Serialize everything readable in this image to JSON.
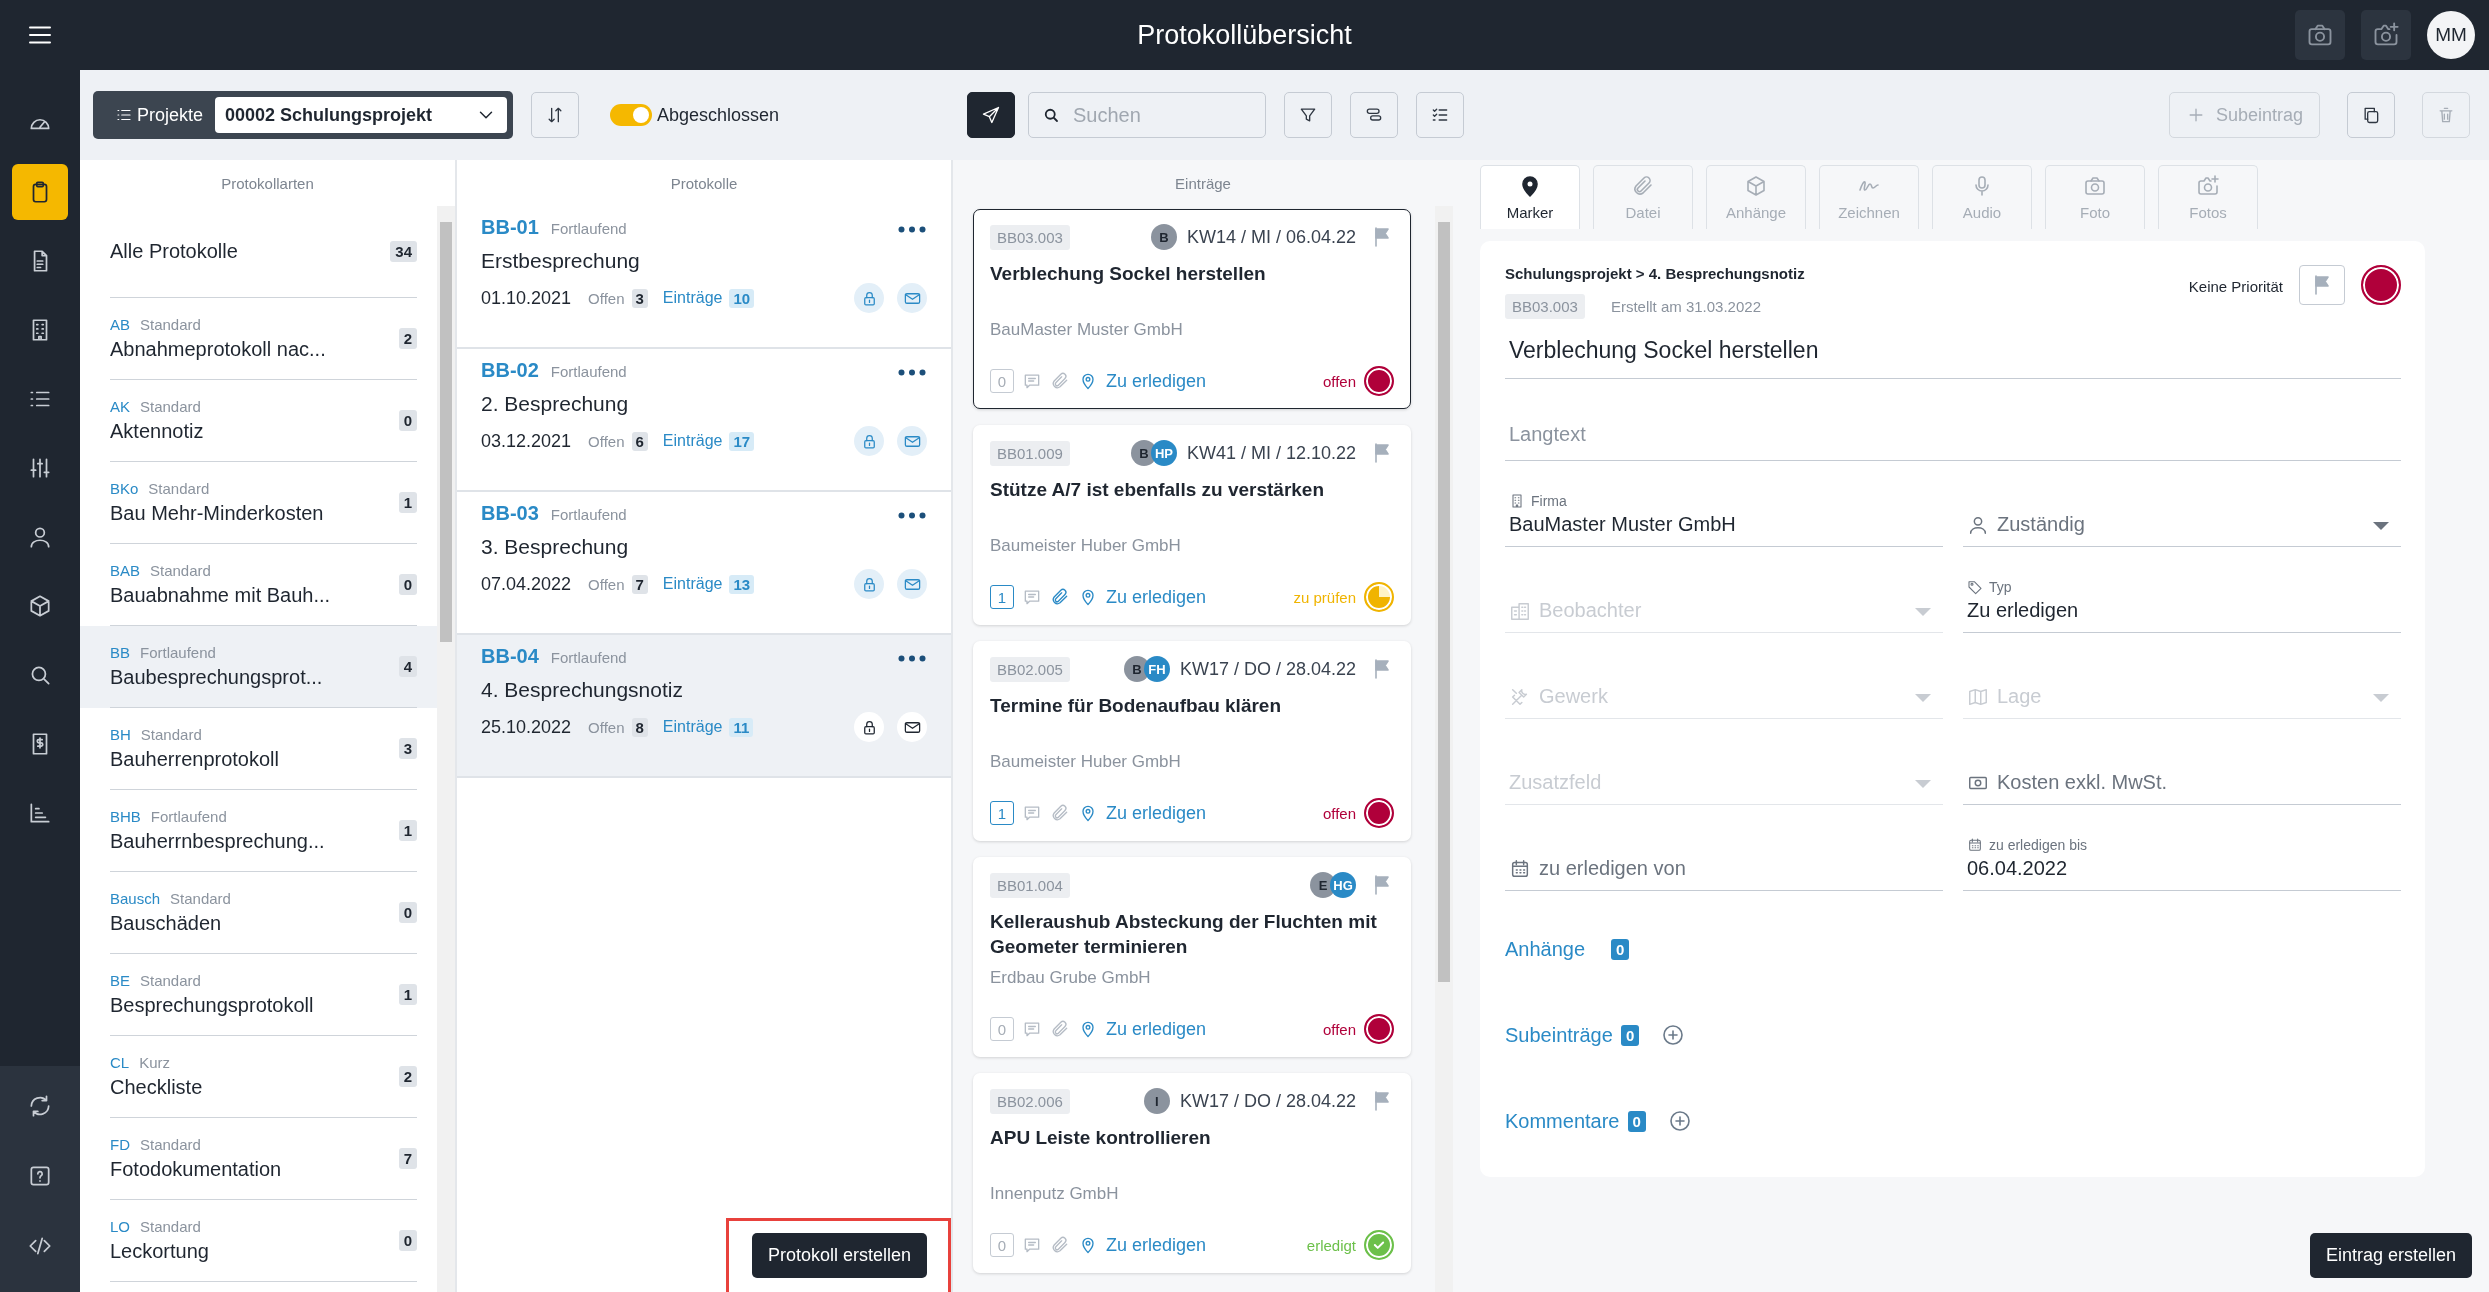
{
  "top_bar": {
    "title": "Protokollübersicht",
    "avatar": "MM"
  },
  "nav_rail": [
    {
      "selected": false
    },
    {
      "selected": true
    },
    {
      "selected": false
    },
    {
      "selected": false
    },
    {
      "selected": false
    },
    {
      "selected": false
    },
    {
      "selected": false
    },
    {
      "selected": false
    },
    {
      "selected": false
    },
    {
      "selected": false
    },
    {
      "selected": false
    }
  ],
  "nav_rail_bottom": [
    {
      "selected": false
    },
    {
      "selected": false
    },
    {
      "selected": false
    }
  ],
  "toolbar": {
    "projects_label": "Projekte",
    "project": "00002 Schulungsprojekt",
    "closed_filter": {
      "label": "Abgeschlossen",
      "on": true
    },
    "search_placeholder": "Suchen",
    "sub_entry_label": "Subeintrag",
    "sub_entry_disabled": true
  },
  "protocol_types": {
    "heading": "Protokollarten",
    "all": {
      "label": "Alle Protokolle",
      "count": "34",
      "selected": false
    },
    "items": [
      {
        "code": "AB",
        "mode": "Standard",
        "name": "Abnahmeprotokoll nac...",
        "count": "2",
        "selected": false
      },
      {
        "code": "AK",
        "mode": "Standard",
        "name": "Aktennotiz",
        "count": "0",
        "selected": false
      },
      {
        "code": "BKo",
        "mode": "Standard",
        "name": "Bau Mehr-Minderkosten",
        "count": "1",
        "selected": false
      },
      {
        "code": "BAB",
        "mode": "Standard",
        "name": "Bauabnahme mit Bauh...",
        "count": "0",
        "selected": false
      },
      {
        "code": "BB",
        "mode": "Fortlaufend",
        "name": "Baubesprechungsprot...",
        "count": "4",
        "selected": true
      },
      {
        "code": "BH",
        "mode": "Standard",
        "name": "Bauherrenprotokoll",
        "count": "3",
        "selected": false
      },
      {
        "code": "BHB",
        "mode": "Fortlaufend",
        "name": "Bauherrnbesprechung...",
        "count": "1",
        "selected": false
      },
      {
        "code": "Bausch",
        "mode": "Standard",
        "name": "Bauschäden",
        "count": "0",
        "selected": false
      },
      {
        "code": "BE",
        "mode": "Standard",
        "name": "Besprechungsprotokoll",
        "count": "1",
        "selected": false
      },
      {
        "code": "CL",
        "mode": "Kurz",
        "name": "Checkliste",
        "count": "2",
        "selected": false
      },
      {
        "code": "FD",
        "mode": "Standard",
        "name": "Fotodokumentation",
        "count": "7",
        "selected": false
      },
      {
        "code": "LO",
        "mode": "Standard",
        "name": "Leckortung",
        "count": "0",
        "selected": false
      }
    ]
  },
  "protocols": {
    "heading": "Protokolle",
    "items": [
      {
        "code": "BB-01",
        "mode": "Fortlaufend",
        "title": "Erstbesprechung",
        "date": "01.10.2021",
        "open_label": "Offen",
        "open": "3",
        "entries_label": "Einträge",
        "entries": "10",
        "selected": false
      },
      {
        "code": "BB-02",
        "mode": "Fortlaufend",
        "title": "2. Besprechung",
        "date": "03.12.2021",
        "open_label": "Offen",
        "open": "6",
        "entries_label": "Einträge",
        "entries": "17",
        "selected": false
      },
      {
        "code": "BB-03",
        "mode": "Fortlaufend",
        "title": "3. Besprechung",
        "date": "07.04.2022",
        "open_label": "Offen",
        "open": "7",
        "entries_label": "Einträge",
        "entries": "13",
        "selected": false
      },
      {
        "code": "BB-04",
        "mode": "Fortlaufend",
        "title": "4. Besprechungsnotiz",
        "date": "25.10.2022",
        "open_label": "Offen",
        "open": "8",
        "entries_label": "Einträge",
        "entries": "11",
        "selected": true
      }
    ],
    "create_button": {
      "label": "Protokoll erstellen",
      "highlighted": true
    }
  },
  "entries": {
    "heading": "Einträge",
    "items": [
      {
        "number": "BB03.003",
        "assignees": [
          {
            "initials": "B",
            "color": "#8b939e"
          }
        ],
        "date": "KW14 / MI / 06.04.22",
        "title": "Verblechung Sockel herstellen",
        "company": "BauMaster Muster GmbH",
        "count": "0",
        "count_active": false,
        "attachment_active": false,
        "type": "Zu erledigen",
        "status": {
          "label": "offen",
          "kind": "open",
          "color": "#b0003a"
        },
        "selected": true
      },
      {
        "number": "BB01.009",
        "assignees": [
          {
            "initials": "B",
            "color": "#8b939e"
          },
          {
            "initials": "HP",
            "color": "#2a8ac6"
          }
        ],
        "date": "KW41 / MI / 12.10.22",
        "title": "Stütze A/7 ist ebenfalls zu verstärken",
        "company": "Baumeister Huber GmbH",
        "count": "1",
        "count_active": true,
        "attachment_active": true,
        "type": "Zu erledigen",
        "status": {
          "label": "zu prüfen",
          "kind": "review",
          "color": "#f0b400"
        },
        "selected": false
      },
      {
        "number": "BB02.005",
        "assignees": [
          {
            "initials": "B",
            "color": "#8b939e"
          },
          {
            "initials": "FH",
            "color": "#2a8ac6"
          }
        ],
        "date": "KW17 / DO / 28.04.22",
        "title": "Termine für Bodenaufbau klären",
        "company": "Baumeister Huber GmbH",
        "count": "1",
        "count_active": true,
        "attachment_active": false,
        "type": "Zu erledigen",
        "status": {
          "label": "offen",
          "kind": "open",
          "color": "#b0003a"
        },
        "selected": false
      },
      {
        "number": "BB01.004",
        "assignees": [
          {
            "initials": "E",
            "color": "#8b939e"
          },
          {
            "initials": "HG",
            "color": "#2a8ac6"
          }
        ],
        "title": "Kelleraushub Absteckung der Fluchten mit Geometer terminieren",
        "company": "Erdbau Grube GmbH",
        "count": "0",
        "count_active": false,
        "attachment_active": false,
        "type": "Zu erledigen",
        "status": {
          "label": "offen",
          "kind": "open",
          "color": "#b0003a"
        },
        "selected": false
      },
      {
        "number": "BB02.006",
        "assignees": [
          {
            "initials": "I",
            "color": "#8b939e"
          }
        ],
        "date": "KW17 / DO / 28.04.22",
        "title": "APU Leiste kontrollieren",
        "company": "Innenputz GmbH",
        "count": "0",
        "count_active": false,
        "attachment_active": false,
        "type": "Zu erledigen",
        "status": {
          "label": "erledigt",
          "kind": "done",
          "color": "#6cc04a"
        },
        "selected": false
      }
    ]
  },
  "detail": {
    "tabs": [
      {
        "label": "Marker",
        "selected": true
      },
      {
        "label": "Datei",
        "selected": false
      },
      {
        "label": "Anhänge",
        "selected": false
      },
      {
        "label": "Zeichnen",
        "selected": false
      },
      {
        "label": "Audio",
        "selected": false
      },
      {
        "label": "Foto",
        "selected": false
      },
      {
        "label": "Fotos",
        "selected": false
      }
    ],
    "breadcrumb": "Schulungsprojekt > 4. Besprechungsnotiz",
    "number": "BB03.003",
    "created": "Erstellt am 31.03.2022",
    "priority_label": "Keine Priorität",
    "status": {
      "kind": "open",
      "color": "#b0003a"
    },
    "title": "Verblechung Sockel herstellen",
    "longtext_placeholder": "Langtext",
    "fields": [
      {
        "kind": "filled",
        "label": "Firma",
        "value": "BauMaster Muster GmbH"
      },
      {
        "kind": "empty",
        "placeholder": "Zuständig",
        "dropdown": true,
        "disabled": false
      },
      {
        "kind": "empty",
        "placeholder": "Beobachter",
        "dropdown": true,
        "disabled": true
      },
      {
        "kind": "filled",
        "label": "Typ",
        "value": "Zu erledigen"
      },
      {
        "kind": "empty",
        "placeholder": "Gewerk",
        "dropdown": true,
        "disabled": true
      },
      {
        "kind": "empty",
        "placeholder": "Lage",
        "dropdown": true,
        "disabled": true
      },
      {
        "kind": "empty",
        "placeholder": "Zusatzfeld",
        "dropdown": true,
        "disabled": true
      },
      {
        "kind": "empty",
        "placeholder": "Kosten exkl. MwSt.",
        "dropdown": false,
        "disabled": false
      },
      {
        "kind": "empty",
        "placeholder": "zu erledigen von",
        "dropdown": false,
        "disabled": false
      },
      {
        "kind": "filled",
        "label": "zu erledigen bis",
        "value": "06.04.2022"
      }
    ],
    "sections": [
      {
        "label": "Anhänge",
        "count": "0",
        "addable": false
      },
      {
        "label": "Subeinträge",
        "count": "0",
        "addable": true
      },
      {
        "label": "Kommentare",
        "count": "0",
        "addable": true
      }
    ],
    "create_button": "Eintrag erstellen"
  }
}
